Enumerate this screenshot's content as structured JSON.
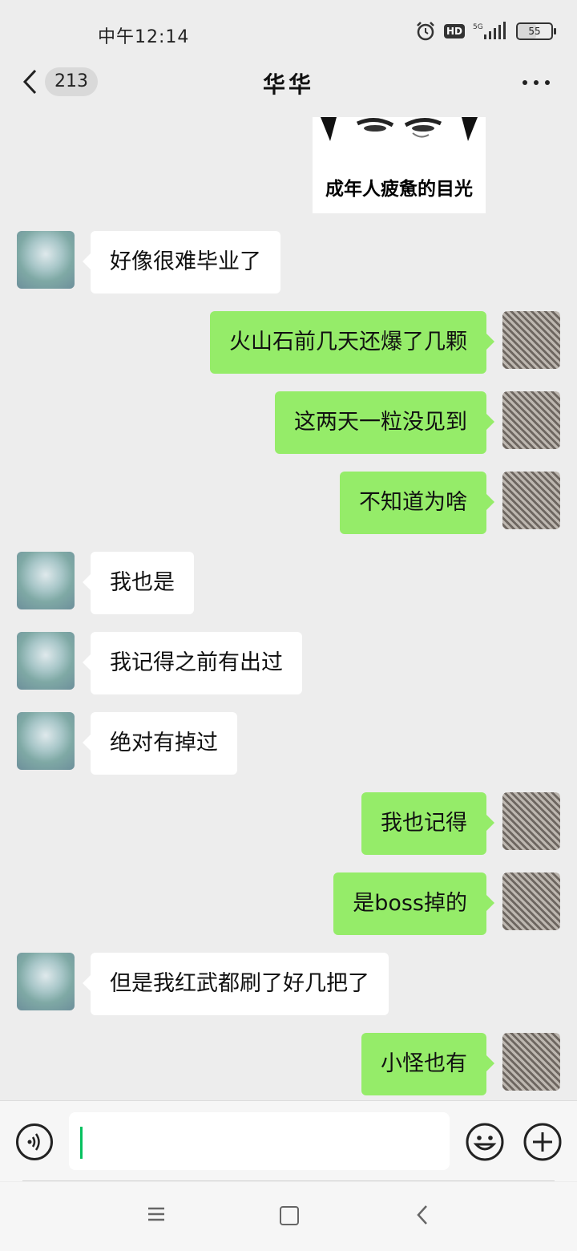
{
  "status_bar": {
    "time": "中午12:14",
    "hd": "HD",
    "network": "5G",
    "battery": "55"
  },
  "header": {
    "unread_count": "213",
    "title": "华华"
  },
  "sticker": {
    "caption": "成年人疲惫的目光"
  },
  "messages": [
    {
      "side": "left",
      "text": "好像很难毕业了"
    },
    {
      "side": "right",
      "text": "火山石前几天还爆了几颗"
    },
    {
      "side": "right",
      "text": "这两天一粒没见到"
    },
    {
      "side": "right",
      "text": "不知道为啥"
    },
    {
      "side": "left",
      "text": "我也是"
    },
    {
      "side": "left",
      "text": "我记得之前有出过"
    },
    {
      "side": "left",
      "text": "绝对有掉过"
    },
    {
      "side": "right",
      "text": "我也记得"
    },
    {
      "side": "right",
      "text": "是boss掉的"
    },
    {
      "side": "left",
      "text": "但是我红武都刷了好几把了"
    },
    {
      "side": "right",
      "text": "小怪也有"
    }
  ],
  "input": {
    "value": ""
  },
  "icons": {
    "back": "chevron-left-icon",
    "more": "more-dots-icon",
    "voice": "voice-icon",
    "emoji": "smiley-icon",
    "add": "plus-circle-icon",
    "nav_menu": "menu-icon",
    "nav_home": "home-square-icon",
    "nav_back": "back-triangle-icon"
  },
  "colors": {
    "sent_bubble": "#95ec69",
    "received_bubble": "#ffffff",
    "background": "#ededed",
    "caret": "#07c160"
  }
}
